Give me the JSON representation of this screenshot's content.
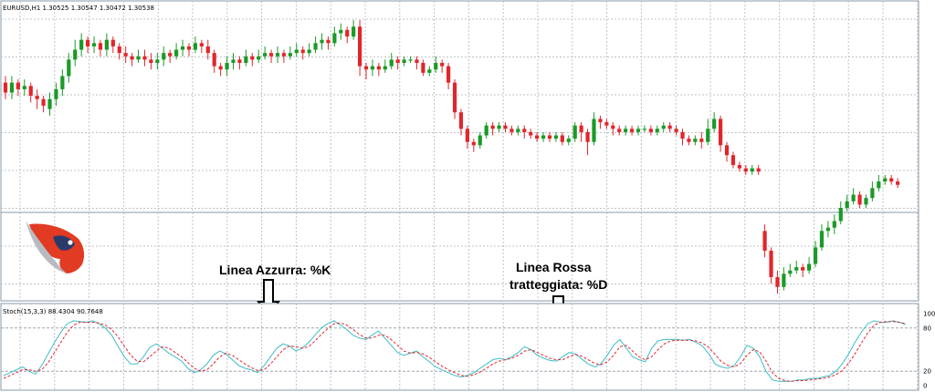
{
  "chart_data": [
    {
      "type": "candlestick",
      "symbol_header": "EURUSD,H1  1.30525 1.30547 1.30472 1.30538",
      "ylim": [
        0,
        100
      ],
      "grid": true,
      "colors": {
        "bullish": "#1a9a28",
        "bearish": "#e0262c",
        "grid": "#bfc3c8",
        "frame": "#8a9aa8"
      },
      "candles": [
        [
          66,
          60,
          70,
          56
        ],
        [
          60,
          66,
          70,
          56
        ],
        [
          66,
          62,
          68,
          58
        ],
        [
          62,
          64,
          68,
          58
        ],
        [
          64,
          58,
          66,
          54
        ],
        [
          58,
          56,
          62,
          50
        ],
        [
          56,
          52,
          58,
          48
        ],
        [
          50,
          56,
          60,
          46
        ],
        [
          56,
          62,
          66,
          52
        ],
        [
          62,
          70,
          74,
          58
        ],
        [
          70,
          80,
          84,
          66
        ],
        [
          80,
          86,
          92,
          76
        ],
        [
          86,
          92,
          96,
          82
        ],
        [
          92,
          88,
          94,
          84
        ],
        [
          88,
          90,
          94,
          84
        ],
        [
          90,
          86,
          92,
          82
        ],
        [
          86,
          92,
          96,
          82
        ],
        [
          92,
          88,
          94,
          84
        ],
        [
          88,
          84,
          90,
          80
        ],
        [
          84,
          82,
          88,
          78
        ],
        [
          82,
          80,
          84,
          76
        ],
        [
          80,
          82,
          86,
          78
        ],
        [
          82,
          80,
          86,
          76
        ],
        [
          80,
          78,
          84,
          74
        ],
        [
          78,
          80,
          84,
          74
        ],
        [
          80,
          84,
          88,
          76
        ],
        [
          84,
          82,
          86,
          78
        ],
        [
          82,
          86,
          90,
          80
        ],
        [
          86,
          88,
          92,
          82
        ],
        [
          88,
          86,
          90,
          82
        ],
        [
          86,
          90,
          94,
          84
        ],
        [
          90,
          88,
          92,
          84
        ],
        [
          88,
          84,
          92,
          80
        ],
        [
          84,
          76,
          86,
          72
        ],
        [
          76,
          74,
          78,
          70
        ],
        [
          74,
          78,
          82,
          70
        ],
        [
          78,
          80,
          84,
          74
        ],
        [
          80,
          78,
          82,
          74
        ],
        [
          78,
          82,
          86,
          76
        ],
        [
          82,
          80,
          84,
          76
        ],
        [
          80,
          82,
          86,
          78
        ],
        [
          82,
          84,
          88,
          80
        ],
        [
          84,
          82,
          86,
          78
        ],
        [
          82,
          84,
          88,
          78
        ],
        [
          84,
          82,
          86,
          78
        ],
        [
          82,
          84,
          88,
          80
        ],
        [
          84,
          86,
          90,
          82
        ],
        [
          86,
          84,
          88,
          80
        ],
        [
          84,
          86,
          90,
          82
        ],
        [
          86,
          90,
          94,
          84
        ],
        [
          90,
          92,
          96,
          86
        ],
        [
          92,
          90,
          94,
          86
        ],
        [
          90,
          96,
          100,
          88
        ],
        [
          96,
          98,
          102,
          92
        ],
        [
          98,
          94,
          100,
          90
        ],
        [
          94,
          100,
          104,
          92
        ],
        [
          100,
          76,
          104,
          70
        ],
        [
          76,
          74,
          78,
          68
        ],
        [
          74,
          76,
          80,
          70
        ],
        [
          76,
          74,
          78,
          70
        ],
        [
          74,
          76,
          80,
          72
        ],
        [
          76,
          80,
          84,
          74
        ],
        [
          80,
          78,
          82,
          74
        ],
        [
          78,
          80,
          82,
          76
        ],
        [
          80,
          80,
          82,
          78
        ],
        [
          80,
          78,
          82,
          74
        ],
        [
          78,
          72,
          80,
          70
        ],
        [
          72,
          74,
          76,
          70
        ],
        [
          74,
          78,
          82,
          72
        ],
        [
          78,
          76,
          80,
          72
        ],
        [
          76,
          66,
          78,
          62
        ],
        [
          66,
          48,
          68,
          44
        ],
        [
          48,
          38,
          50,
          34
        ],
        [
          38,
          30,
          40,
          26
        ],
        [
          30,
          28,
          32,
          24
        ],
        [
          28,
          34,
          36,
          26
        ],
        [
          34,
          40,
          42,
          32
        ],
        [
          40,
          38,
          42,
          34
        ],
        [
          38,
          40,
          42,
          36
        ],
        [
          40,
          38,
          42,
          36
        ],
        [
          38,
          36,
          40,
          34
        ],
        [
          36,
          38,
          40,
          34
        ],
        [
          38,
          36,
          40,
          32
        ],
        [
          36,
          34,
          38,
          32
        ],
        [
          34,
          32,
          36,
          30
        ],
        [
          32,
          34,
          36,
          30
        ],
        [
          34,
          32,
          36,
          30
        ],
        [
          32,
          34,
          36,
          30
        ],
        [
          34,
          30,
          36,
          28
        ],
        [
          30,
          32,
          34,
          28
        ],
        [
          32,
          40,
          42,
          30
        ],
        [
          40,
          36,
          42,
          30
        ],
        [
          36,
          30,
          38,
          22
        ],
        [
          30,
          44,
          48,
          28
        ],
        [
          44,
          42,
          46,
          38
        ],
        [
          42,
          40,
          44,
          38
        ],
        [
          40,
          38,
          42,
          34
        ],
        [
          38,
          36,
          40,
          34
        ],
        [
          36,
          38,
          40,
          34
        ],
        [
          38,
          36,
          40,
          34
        ],
        [
          36,
          38,
          40,
          34
        ],
        [
          38,
          38,
          40,
          36
        ],
        [
          38,
          36,
          40,
          34
        ],
        [
          36,
          38,
          40,
          34
        ],
        [
          38,
          40,
          42,
          36
        ],
        [
          40,
          38,
          42,
          36
        ],
        [
          38,
          36,
          40,
          34
        ],
        [
          36,
          32,
          38,
          28
        ],
        [
          32,
          30,
          34,
          28
        ],
        [
          30,
          32,
          34,
          28
        ],
        [
          32,
          30,
          36,
          26
        ],
        [
          30,
          38,
          44,
          28
        ],
        [
          38,
          44,
          48,
          36
        ],
        [
          44,
          28,
          46,
          24
        ],
        [
          28,
          22,
          30,
          18
        ],
        [
          22,
          16,
          24,
          14
        ],
        [
          16,
          14,
          18,
          12
        ],
        [
          14,
          12,
          16,
          10
        ],
        [
          12,
          14,
          16,
          10
        ],
        [
          14,
          12,
          16,
          10
        ],
        [
          -24,
          -36,
          -20,
          -40
        ],
        [
          -36,
          -52,
          -34,
          -56
        ],
        [
          -52,
          -58,
          -48,
          -62
        ],
        [
          -58,
          -50,
          -46,
          -60
        ],
        [
          -50,
          -48,
          -44,
          -52
        ],
        [
          -48,
          -46,
          -42,
          -50
        ],
        [
          -46,
          -48,
          -44,
          -52
        ],
        [
          -48,
          -44,
          -40,
          -50
        ],
        [
          -44,
          -34,
          -30,
          -46
        ],
        [
          -34,
          -24,
          -20,
          -36
        ],
        [
          -24,
          -22,
          -18,
          -28
        ],
        [
          -22,
          -18,
          -14,
          -26
        ],
        [
          -18,
          -10,
          -6,
          -20
        ],
        [
          -10,
          -6,
          -2,
          -12
        ],
        [
          -6,
          -2,
          2,
          -8
        ],
        [
          -2,
          -8,
          0,
          -10
        ],
        [
          -8,
          -4,
          -2,
          -10
        ],
        [
          -4,
          2,
          6,
          -6
        ],
        [
          2,
          6,
          10,
          0
        ],
        [
          6,
          8,
          10,
          4
        ],
        [
          8,
          6,
          10,
          4
        ],
        [
          6,
          4,
          8,
          2
        ]
      ]
    },
    {
      "type": "line",
      "title": "Stoch(15,3,3) 88.4304 90.7648",
      "ylim": [
        0,
        100
      ],
      "y_ticks": [
        "100",
        "80",
        "20",
        "0"
      ],
      "grid": true,
      "series": [
        {
          "color": "#3fbcc8",
          "style": "solid",
          "values": [
            14,
            18,
            22,
            26,
            20,
            16,
            28,
            44,
            60,
            74,
            86,
            90,
            89,
            88,
            90,
            86,
            80,
            70,
            55,
            40,
            30,
            30,
            40,
            53,
            58,
            52,
            45,
            40,
            34,
            24,
            18,
            22,
            30,
            42,
            48,
            44,
            36,
            28,
            24,
            22,
            18,
            28,
            40,
            52,
            58,
            55,
            48,
            52,
            60,
            70,
            80,
            86,
            90,
            84,
            78,
            70,
            66,
            64,
            70,
            76,
            66,
            56,
            46,
            42,
            45,
            48,
            40,
            33,
            26,
            22,
            18,
            14,
            12,
            14,
            18,
            24,
            30,
            36,
            38,
            36,
            40,
            46,
            54,
            50,
            42,
            38,
            35,
            34,
            40,
            46,
            44,
            37,
            30,
            26,
            30,
            42,
            56,
            64,
            52,
            40,
            36,
            33,
            52,
            62,
            64,
            64,
            64,
            63,
            64,
            60,
            55,
            44,
            30,
            26,
            24,
            28,
            40,
            56,
            52,
            40,
            20,
            8,
            6,
            6,
            6,
            8,
            8,
            10,
            10,
            12,
            14,
            20,
            30,
            44,
            60,
            74,
            86,
            90,
            88,
            88,
            90,
            88,
            85
          ]
        },
        {
          "color": "#e0262c",
          "style": "dashed",
          "values": [
            10,
            14,
            18,
            22,
            22,
            20,
            22,
            32,
            46,
            60,
            74,
            84,
            88,
            88,
            88,
            87,
            84,
            78,
            68,
            55,
            42,
            34,
            33,
            40,
            48,
            54,
            52,
            46,
            40,
            32,
            24,
            20,
            22,
            30,
            40,
            45,
            42,
            36,
            30,
            25,
            21,
            22,
            30,
            40,
            50,
            55,
            54,
            52,
            54,
            62,
            71,
            79,
            86,
            87,
            84,
            78,
            71,
            66,
            66,
            70,
            70,
            64,
            56,
            48,
            45,
            46,
            44,
            39,
            33,
            27,
            22,
            18,
            14,
            13,
            15,
            19,
            24,
            30,
            34,
            36,
            38,
            42,
            48,
            50,
            46,
            42,
            38,
            36,
            36,
            40,
            43,
            41,
            36,
            31,
            29,
            33,
            42,
            54,
            56,
            48,
            40,
            36,
            40,
            50,
            58,
            62,
            63,
            63,
            63,
            62,
            59,
            53,
            43,
            33,
            28,
            26,
            31,
            42,
            50,
            47,
            34,
            18,
            10,
            7,
            6,
            7,
            7,
            8,
            9,
            10,
            12,
            15,
            21,
            31,
            44,
            59,
            73,
            84,
            88,
            89,
            89,
            88,
            86
          ]
        }
      ]
    }
  ],
  "annotations": {
    "k_line": "Linea Azzurra: %K",
    "d_line_1": "Linea Rossa",
    "d_line_2": "tratteggiata: %D"
  }
}
